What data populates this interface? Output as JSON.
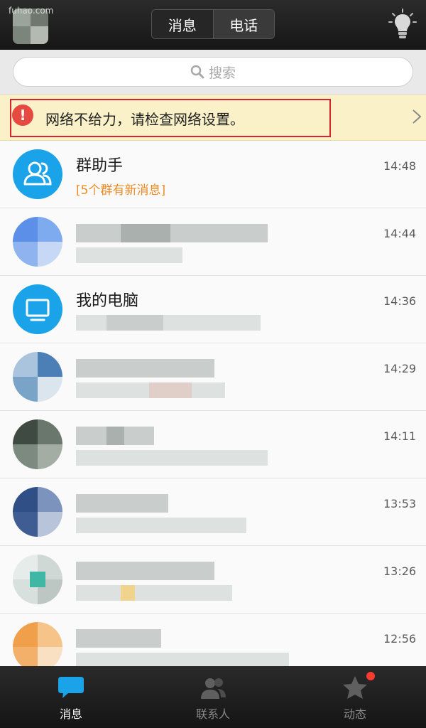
{
  "watermark": "fuhao.com",
  "header": {
    "tabs": [
      {
        "label": "消息",
        "active": true
      },
      {
        "label": "电话",
        "active": false
      }
    ],
    "bulb_icon": "lightbulb-icon"
  },
  "search": {
    "placeholder": "搜索",
    "icon": "search-icon"
  },
  "network_warning": {
    "text": "网络不给力，请检查网络设置。",
    "icon": "exclamation-icon",
    "accent": "#e5493f",
    "frame_color": "#d6262b"
  },
  "conversations": [
    {
      "name": "群助手",
      "subtitle": "[5个群有新消息]",
      "time": "14:48",
      "avatar_color": "#1aa3e8",
      "avatar_icon": "group-icon"
    },
    {
      "name": "",
      "subtitle": "",
      "time": "14:44",
      "avatar_color": "#5b8fe8"
    },
    {
      "name": "我的电脑",
      "subtitle": "",
      "time": "14:36",
      "avatar_color": "#1aa3e8",
      "avatar_icon": "computer-icon"
    },
    {
      "name": "",
      "subtitle": "",
      "time": "14:29",
      "avatar_color": "#6f9fc9"
    },
    {
      "name": "",
      "subtitle": "",
      "time": "14:11",
      "avatar_color": "#5a6b5e"
    },
    {
      "name": "",
      "subtitle": "",
      "time": "13:53",
      "avatar_color": "#3f5d93"
    },
    {
      "name": "",
      "subtitle": "",
      "time": "13:26",
      "avatar_color": "#7fbfb0"
    },
    {
      "name": "",
      "subtitle": "",
      "time": "12:56",
      "avatar_color": "#f0a04b"
    }
  ],
  "bottom_nav": [
    {
      "label": "消息",
      "icon": "chat-bubble-icon",
      "active": true
    },
    {
      "label": "联系人",
      "icon": "contacts-icon",
      "active": false
    },
    {
      "label": "动态",
      "icon": "star-icon",
      "active": false,
      "badge": true
    }
  ],
  "colors": {
    "accent": "#1aa3e8",
    "header_bg": "#1e1e1e",
    "badge": "#ff3b30",
    "subtitle": "#ef8a23"
  }
}
